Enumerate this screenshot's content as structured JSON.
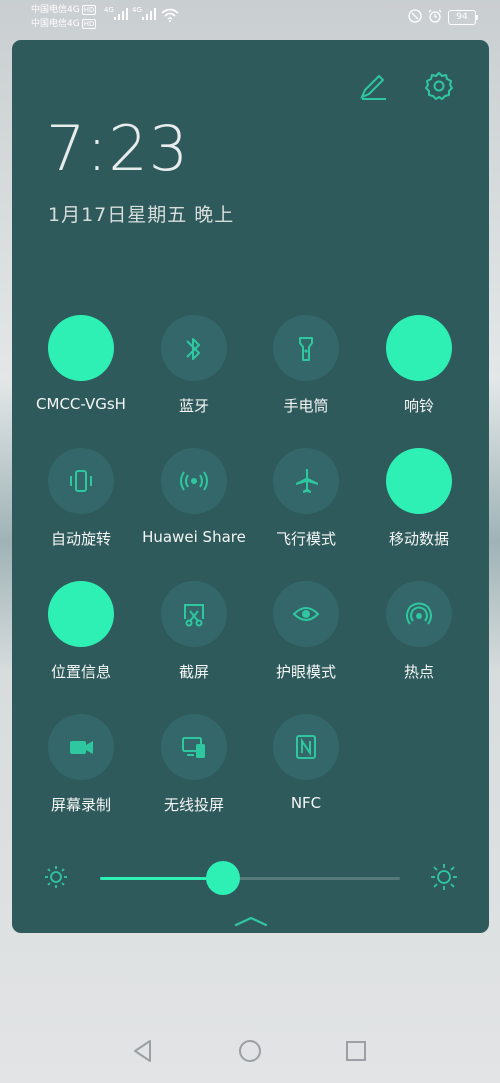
{
  "status_bar": {
    "carrier1": "中国电信4G",
    "carrier2": "中国电信4G",
    "hd_badge": "HD",
    "net1": "4G",
    "net2": "4G",
    "battery": "94"
  },
  "panel": {
    "time": "7:23",
    "date": "1月17日星期五 晚上",
    "tiles": [
      {
        "label": "CMCC-VGsH",
        "icon": "wifi-icon",
        "on": true
      },
      {
        "label": "蓝牙",
        "icon": "bluetooth-icon",
        "on": false
      },
      {
        "label": "手电筒",
        "icon": "flashlight-icon",
        "on": false
      },
      {
        "label": "响铃",
        "icon": "bell-icon",
        "on": true
      },
      {
        "label": "自动旋转",
        "icon": "auto-rotate-icon",
        "on": false
      },
      {
        "label": "Huawei Share",
        "icon": "huawei-share-icon",
        "on": false
      },
      {
        "label": "飞行模式",
        "icon": "airplane-icon",
        "on": false
      },
      {
        "label": "移动数据",
        "icon": "mobile-data-icon",
        "on": true
      },
      {
        "label": "位置信息",
        "icon": "location-icon",
        "on": true
      },
      {
        "label": "截屏",
        "icon": "screenshot-icon",
        "on": false
      },
      {
        "label": "护眼模式",
        "icon": "eye-icon",
        "on": false
      },
      {
        "label": "热点",
        "icon": "hotspot-icon",
        "on": false
      },
      {
        "label": "屏幕录制",
        "icon": "screen-record-icon",
        "on": false
      },
      {
        "label": "无线投屏",
        "icon": "wireless-projection-icon",
        "on": false
      },
      {
        "label": "NFC",
        "icon": "nfc-icon",
        "on": false
      }
    ],
    "brightness": 0.41
  },
  "colors": {
    "panel_bg": "#2f5a5c",
    "tile_off": "#346769",
    "accent": "#2ef0b4",
    "icon_off": "#2ec7a0"
  }
}
